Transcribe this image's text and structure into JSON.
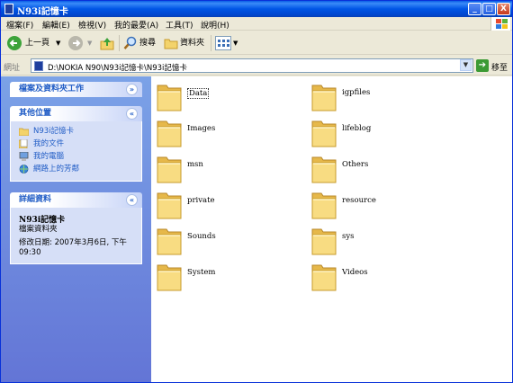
{
  "window": {
    "title": "N93i記憶卡"
  },
  "title_buttons": {
    "minimize": "_",
    "maximize": "□",
    "close": "X"
  },
  "menu": [
    "檔案(F)",
    "編輯(E)",
    "檢視(V)",
    "我的最愛(A)",
    "工具(T)",
    "說明(H)"
  ],
  "toolbar": {
    "back_label": "上一頁",
    "search_label": "搜尋",
    "folders_label": "資料夾"
  },
  "address": {
    "label": "網址",
    "value": "D:\\NOKIA N90\\N93i記憶卡\\N93i記憶卡",
    "go_label": "移至"
  },
  "tasks_panel": {
    "title": "檔案及資料夾工作"
  },
  "places_panel": {
    "title": "其他位置",
    "items": [
      {
        "label": "N93i記憶卡",
        "icon": "folder-icon"
      },
      {
        "label": "我的文件",
        "icon": "documents-icon"
      },
      {
        "label": "我的電腦",
        "icon": "computer-icon"
      },
      {
        "label": "網路上的芳鄰",
        "icon": "network-icon"
      }
    ]
  },
  "details_panel": {
    "title": "詳細資料",
    "name": "N93i記憶卡",
    "type": "檔案資料夾",
    "modified_line1": "修改日期: 2007年3月6日, 下午",
    "modified_line2": "09:30"
  },
  "folders": [
    {
      "name": "Data",
      "selected": true
    },
    {
      "name": "igpfiles"
    },
    {
      "name": "Images"
    },
    {
      "name": "lifeblog"
    },
    {
      "name": "msn"
    },
    {
      "name": "Others"
    },
    {
      "name": "private"
    },
    {
      "name": "resource"
    },
    {
      "name": "Sounds"
    },
    {
      "name": "sys"
    },
    {
      "name": "System"
    },
    {
      "name": "Videos"
    }
  ],
  "colors": {
    "title_blue": "#0055e5",
    "task_blue": "#215dc6",
    "folder_yellow": "#f3d36b"
  }
}
